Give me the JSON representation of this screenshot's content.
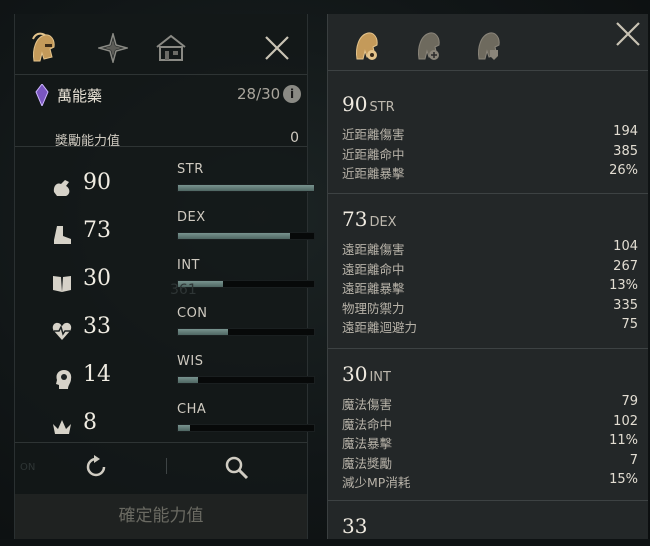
{
  "left_panel": {
    "tabs": [
      {
        "icon": "helmet-icon",
        "active": true
      },
      {
        "icon": "compass-star-icon",
        "active": false
      },
      {
        "icon": "house-icon",
        "active": false
      }
    ],
    "potion": {
      "name": "萬能藥",
      "count": "28/30",
      "info_icon": "info-icon"
    },
    "bonus": {
      "label": "獎勵能力值",
      "value": "0"
    },
    "stats": [
      {
        "icon": "strength-arm-icon",
        "value": "90",
        "name": "STR",
        "fill": 1.0
      },
      {
        "icon": "boot-icon",
        "value": "73",
        "name": "DEX",
        "fill": 0.82
      },
      {
        "icon": "book-icon",
        "value": "30",
        "name": "INT",
        "fill": 0.33
      },
      {
        "icon": "heart-pulse-icon",
        "value": "33",
        "name": "CON",
        "fill": 0.37
      },
      {
        "icon": "head-profile-icon",
        "value": "14",
        "name": "WIS",
        "fill": 0.15
      },
      {
        "icon": "crown-icon",
        "value": "8",
        "name": "CHA",
        "fill": 0.09
      }
    ],
    "reset_icon": "reset-icon",
    "search_icon": "magnifier-icon",
    "confirm_label": "確定能力值",
    "ghost_toggle_label": "ON",
    "ghost_number": "361"
  },
  "right_panel": {
    "tabs": [
      {
        "icon": "helmet-gear-icon",
        "active": true
      },
      {
        "icon": "helmet-plus-icon",
        "active": false
      },
      {
        "icon": "helmet-shield-icon",
        "active": false
      }
    ],
    "sections": [
      {
        "value": "90",
        "stat": "STR",
        "rows": [
          {
            "label": "近距離傷害",
            "value": "194"
          },
          {
            "label": "近距離命中",
            "value": "385"
          },
          {
            "label": "近距離暴擊",
            "value": "26%"
          }
        ]
      },
      {
        "value": "73",
        "stat": "DEX",
        "rows": [
          {
            "label": "遠距離傷害",
            "value": "104"
          },
          {
            "label": "遠距離命中",
            "value": "267"
          },
          {
            "label": "遠距離暴擊",
            "value": "13%"
          },
          {
            "label": "物理防禦力",
            "value": "335"
          },
          {
            "label": "遠距離迴避力",
            "value": "75"
          }
        ]
      },
      {
        "value": "30",
        "stat": "INT",
        "rows": [
          {
            "label": "魔法傷害",
            "value": "79"
          },
          {
            "label": "魔法命中",
            "value": "102"
          },
          {
            "label": "魔法暴擊",
            "value": "11%"
          },
          {
            "label": "魔法獎勵",
            "value": "7"
          },
          {
            "label": "減少MP消耗",
            "value": "15%"
          }
        ]
      },
      {
        "value": "33",
        "stat": "",
        "rows": []
      }
    ]
  },
  "colors": {
    "accent_gold": "#c9a46a",
    "bar_fill": "#6f8a86",
    "panel_bg": "#232728"
  }
}
